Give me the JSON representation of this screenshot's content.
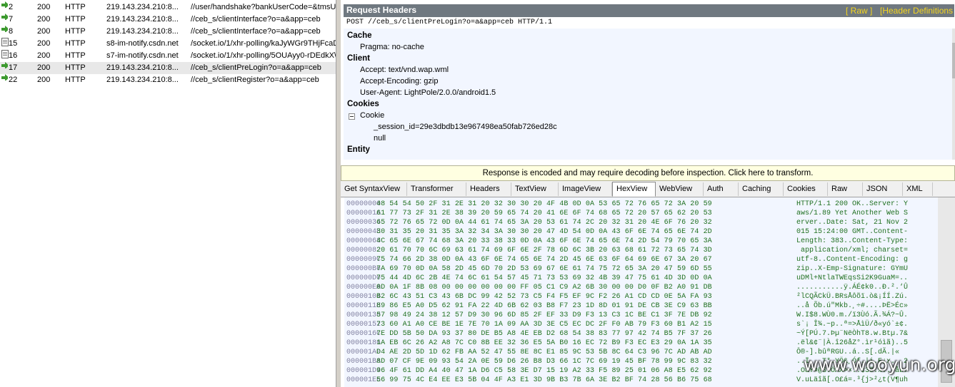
{
  "sessions": [
    {
      "icon": "arrow-icon",
      "num": "2",
      "result": "200",
      "protocol": "HTTP",
      "host": "219.143.234.210:8...",
      "url": "//user/handshake?bankUserCode=&tmsUs",
      "selected": false
    },
    {
      "icon": "arrow-icon",
      "num": "7",
      "result": "200",
      "protocol": "HTTP",
      "host": "219.143.234.210:8...",
      "url": "//ceb_s/clientInterface?o=a&app=ceb",
      "selected": false
    },
    {
      "icon": "arrow-icon",
      "num": "8",
      "result": "200",
      "protocol": "HTTP",
      "host": "219.143.234.210:8...",
      "url": "//ceb_s/clientInterface?o=a&app=ceb",
      "selected": false
    },
    {
      "icon": "document-icon",
      "num": "15",
      "result": "200",
      "protocol": "HTTP",
      "host": "s8-im-notify.csdn.net",
      "url": "/socket.io/1/xhr-polling/kaJyWGr9THjFcaD",
      "selected": false
    },
    {
      "icon": "document-icon",
      "num": "16",
      "result": "200",
      "protocol": "HTTP",
      "host": "s7-im-notify.csdn.net",
      "url": "/socket.io/1/xhr-polling/5OUAyy0-rDEdkX\\",
      "selected": false
    },
    {
      "icon": "arrow-icon",
      "num": "17",
      "result": "200",
      "protocol": "HTTP",
      "host": "219.143.234.210:8...",
      "url": "//ceb_s/clientPreLogin?o=a&app=ceb",
      "selected": true
    },
    {
      "icon": "arrow-icon",
      "num": "22",
      "result": "200",
      "protocol": "HTTP",
      "host": "219.143.234.210:8...",
      "url": "//ceb_s/clientRegister?o=a&app=ceb",
      "selected": false
    }
  ],
  "request": {
    "title": "Request Headers",
    "raw_link": "[ Raw ]",
    "defs_link": "[Header Definitions",
    "request_line": "POST //ceb_s/clientPreLogin?o=a&app=ceb HTTP/1.1",
    "groups": {
      "cache": "Cache",
      "cache_pragma": "Pragma: no-cache",
      "client": "Client",
      "client_accept": "Accept: text/vnd.wap.wml",
      "client_encoding": "Accept-Encoding: gzip",
      "client_ua": "User-Agent: LightPole/2.0.0/android1.5",
      "cookies": "Cookies",
      "cookie_label": "Cookie",
      "cookie_session": "_session_id=29e3dbdb13e967498ea50fab726ed28c",
      "cookie_null": "null",
      "entity": "Entity"
    }
  },
  "notice": "Response is encoded and may require decoding before inspection. Click here to transform.",
  "tabs": [
    "Get SyntaxView",
    "Transformer",
    "Headers",
    "TextView",
    "ImageView",
    "HexView",
    "WebView",
    "Auth",
    "Caching",
    "Cookies",
    "Raw",
    "JSON",
    "XML"
  ],
  "active_tab": "HexView",
  "hex_rows": [
    {
      "off": "00000000",
      "hex": "48 54 54 50 2F 31 2E 31 20 32 30 30 20 4F 4B 0D 0A 53 65 72 76 65 72 3A 20 59",
      "ascii": "HTTP/1.1 200 OK..Server: Y"
    },
    {
      "off": "0000001A",
      "hex": "61 77 73 2F 31 2E 38 39 20 59 65 74 20 41 6E 6F 74 68 65 72 20 57 65 62 20 53",
      "ascii": "aws/1.89 Yet Another Web S"
    },
    {
      "off": "00000034",
      "hex": "65 72 76 65 72 0D 0A 44 61 74 65 3A 20 53 61 74 2C 20 32 31 20 4E 6F 76 20 32",
      "ascii": "erver..Date: Sat, 21 Nov 2"
    },
    {
      "off": "0000004E",
      "hex": "30 31 35 20 31 35 3A 32 34 3A 30 30 20 47 4D 54 0D 0A 43 6F 6E 74 65 6E 74 2D",
      "ascii": "015 15:24:00 GMT..Content-"
    },
    {
      "off": "00000068",
      "hex": "4C 65 6E 67 74 68 3A 20 33 38 33 0D 0A 43 6F 6E 74 65 6E 74 2D 54 79 70 65 3A",
      "ascii": "Length: 383..Content-Type:"
    },
    {
      "off": "00000082",
      "hex": "20 61 70 70 6C 69 63 61 74 69 6F 6E 2F 78 6D 6C 3B 20 63 68 61 72 73 65 74 3D",
      "ascii": " application/xml; charset="
    },
    {
      "off": "0000009C",
      "hex": "75 74 66 2D 38 0D 0A 43 6F 6E 74 65 6E 74 2D 45 6E 63 6F 64 69 6E 67 3A 20 67",
      "ascii": "utf-8..Content-Encoding: g"
    },
    {
      "off": "000000B6",
      "hex": "7A 69 70 0D 0A 58 2D 45 6D 70 2D 53 69 67 6E 61 74 75 72 65 3A 20 47 59 6D 55",
      "ascii": "zip..X-Emp-Signature: GYmU"
    },
    {
      "off": "000000D0",
      "hex": "75 44 4D 6C 2B 4E 74 6C 61 54 57 45 71 73 53 69 32 4B 39 47 75 61 4D 3D 0D 0A",
      "ascii": "uDMl+NtlaTWEqsSi2K9GuaM=.."
    },
    {
      "off": "000000EA",
      "hex": "0D 0A 1F 8B 08 00 00 00 00 00 00 FF 05 C1 C9 A2 6B 30 00 00 D0 0F B2 A0 91 DB",
      "ascii": "...........ÿ.ÁÉ¢k0..Ð.².‘Û"
    },
    {
      "off": "00000104",
      "hex": "B2 6C 43 51 C3 43 6B DC 99 42 52 73 C5 F4 F5 EF 9C F2 26 A1 CD CD 0E 5A FA 93",
      "ascii": "²lCQÃCkÜ.BRsÅôõï.ò&¡ÍÍ.Zú."
    },
    {
      "off": "0000011E",
      "hex": "89 86 E5 A0 D5 62 91 FA 22 4D 6B 62 03 B8 F7 23 1D 8D 01 91 DE CB 3E C9 63 BB",
      "ascii": "..å Õb.ú\"Mkb.¸÷#....ÞË>Éc»"
    },
    {
      "off": "00000138",
      "hex": "57 98 49 24 38 12 57 D9 30 96 6D 85 2F EF 33 D9 F3 13 C3 1C BE C1 3F 7E DB 92",
      "ascii": "W.I$8.WÙ0.m./ï3Ùó.Ã.¾Á?~Û."
    },
    {
      "off": "00000152",
      "hex": "73 60 A1 A0 CE BE 1E 7E 70 1A 09 AA 3D 3E C5 EC DC 2F F0 AB 79 F3 60 B1 A2 15",
      "ascii": "s`¡ Î¾.~p..ª=>ÅìÜ/ð«yó`±¢."
    },
    {
      "off": "0000016C",
      "hex": "7E DD 5B 50 DA 93 37 80 DE B5 A8 4E EB D2 68 54 38 83 77 97 42 74 B5 7F 37 26",
      "ascii": "~Ý[PÚ.7.Þµ¨NëÒhT8.w.Btµ.7&"
    },
    {
      "off": "00000186",
      "hex": "1A EB 6C 26 A2 A8 7C C0 8B EE 32 36 E5 5A B0 16 EC 72 B9 F3 EC E3 29 0A 1A 35",
      "ascii": ".ël&¢¨|À.î26åZ°.ìr¹óìã)..5"
    },
    {
      "off": "000001A0",
      "hex": "D4 AE 2D 5D 1D 62 FB AA 52 47 55 8E 8C E1 85 9C 53 5B 8C 64 C3 96 7C AD AB AD",
      "ascii": "Ô®-].bûªRGU..á..S[.dÃ.|­«­"
    },
    {
      "off": "000001BA",
      "hex": "8D 07 CF 9E 09 93 54 2A 0E 59 D6 26 B8 D3 66 1C 7C 69 19 45 BF 78 99 9C 83 32",
      "ascii": "..Ï...T*.YÖ&¸Óf.|i.E¿x...2"
    },
    {
      "off": "000001D4",
      "hex": "96 4F 61 DD A4 40 47 1A D6 C5 58 3E D7 15 19 A2 33 F5 89 25 01 06 A8 E5 62 92",
      "ascii": ".OaÝ¤@G.ÖÅX>×..¢3õ.%..¨åb."
    },
    {
      "off": "000001EE",
      "hex": "56 99 75 4C E4 EE E3 5B 04 4F A3 E1 3D 9B B3 7B 6A 3E B2 BF 74 28 56 B6 75 68",
      "ascii": "V.uLäîã[.O£á=.³{j>²¿t(V¶uh"
    }
  ],
  "watermark": "www.wooyun.org"
}
